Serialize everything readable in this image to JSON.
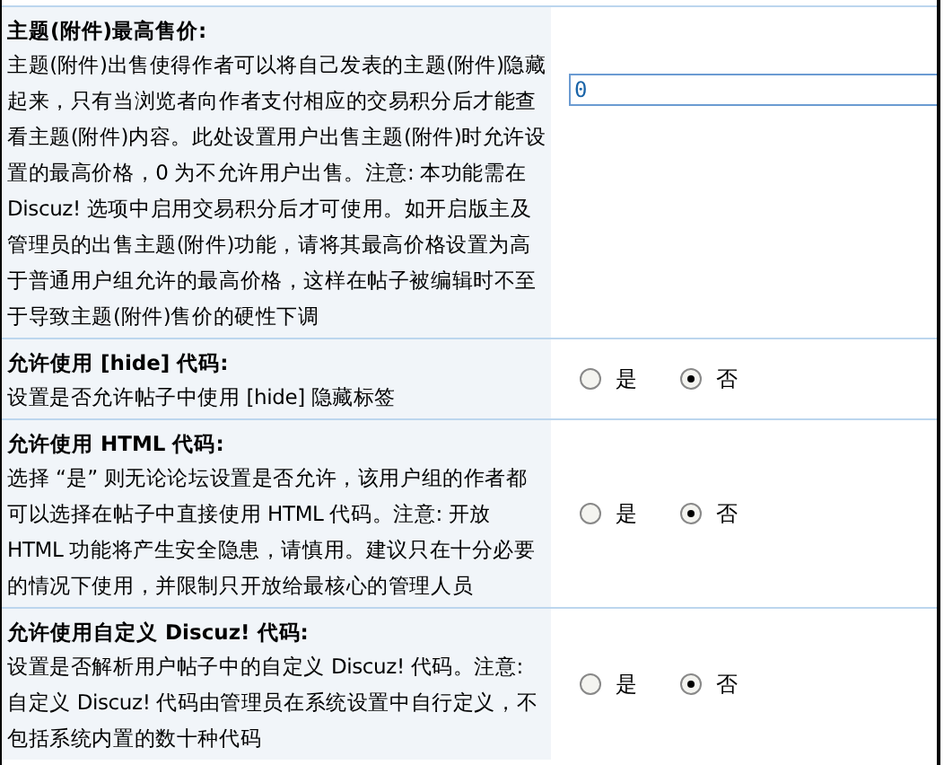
{
  "settings": [
    {
      "kind": "text",
      "title": "主题(附件)最高售价:",
      "description": "主题(附件)出售使得作者可以将自己发表的主题(附件)隐藏起来，只有当浏览者向作者支付相应的交易积分后才能查看主题(附件)内容。此处设置用户出售主题(附件)时允许设置的最高价格，0 为不允许用户出售。注意: 本功能需在 Discuz! 选项中启用交易积分后才可使用。如开启版主及管理员的出售主题(附件)功能，请将其最高价格设置为高于普通用户组允许的最高价格，这样在帖子被编辑时不至于导致主题(附件)售价的硬性下调",
      "value": "0"
    },
    {
      "kind": "radio",
      "title": "允许使用  [hide] 代码:",
      "description": "设置是否允许帖子中使用  [hide] 隐藏标签",
      "options": [
        {
          "label": "是",
          "selected": false
        },
        {
          "label": "否",
          "selected": true
        }
      ]
    },
    {
      "kind": "radio",
      "title": "允许使用  HTML 代码:",
      "description": "选择 “是” 则无论论坛设置是否允许，该用户组的作者都可以选择在帖子中直接使用  HTML 代码。注意: 开放 HTML 功能将产生安全隐患，请慎用。建议只在十分必要的情况下使用，并限制只开放给最核心的管理人员",
      "options": [
        {
          "label": "是",
          "selected": false
        },
        {
          "label": "否",
          "selected": true
        }
      ]
    },
    {
      "kind": "radio",
      "title": "允许使用自定义  Discuz! 代码:",
      "description": "设置是否解析用户帖子中的自定义  Discuz! 代码。注意: 自定义  Discuz! 代码由管理员在系统设置中自行定义，不包括系统内置的数十种代码",
      "options": [
        {
          "label": "是",
          "selected": false
        },
        {
          "label": "否",
          "selected": true
        }
      ]
    }
  ]
}
